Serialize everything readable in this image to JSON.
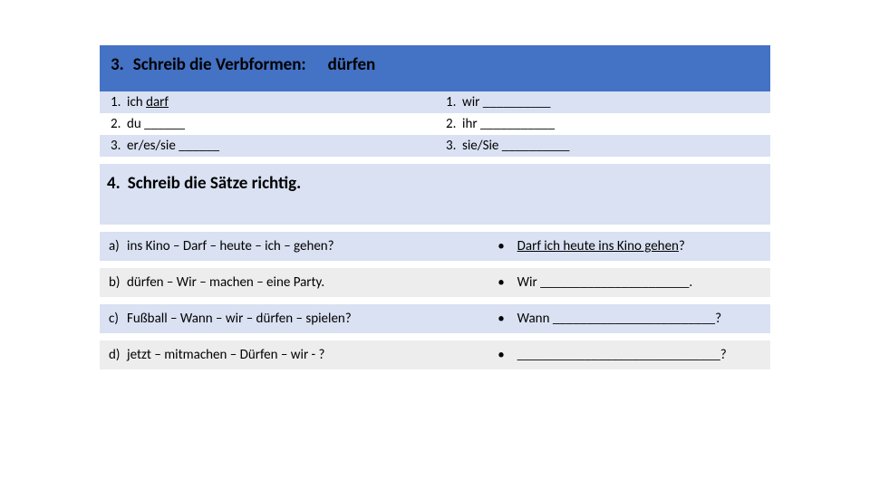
{
  "ex3": {
    "number": "3.",
    "title": "Schreib die Verbformen:",
    "verb": "dürfen",
    "left": [
      {
        "n": "1.",
        "pre": "ich ",
        "u": "darf",
        "post": ""
      },
      {
        "n": "2.",
        "pre": "du ______",
        "u": "",
        "post": ""
      },
      {
        "n": "3.",
        "pre": "er/es/sie ______",
        "u": "",
        "post": ""
      }
    ],
    "right": [
      {
        "n": "1.",
        "pre": "wir __________",
        "u": "",
        "post": ""
      },
      {
        "n": "2.",
        "pre": "ihr ___________",
        "u": "",
        "post": ""
      },
      {
        "n": "3.",
        "pre": "sie/Sie __________",
        "u": "",
        "post": ""
      }
    ]
  },
  "ex4": {
    "number": "4.",
    "title": "Schreib die Sätze richtig.",
    "rows": [
      {
        "letter": "a)",
        "prompt": "ins Kino – Darf – heute – ich – gehen?",
        "bullet": "•",
        "ans_pre": "",
        "ans_u": "Darf ich heute ins Kino gehen",
        "ans_post": "?"
      },
      {
        "letter": "b)",
        "prompt": "dürfen – Wir – machen – eine Party.",
        "bullet": "•",
        "ans_pre": "Wir ______________________.",
        "ans_u": "",
        "ans_post": ""
      },
      {
        "letter": "c)",
        "prompt": "Fußball – Wann – wir – dürfen – spielen?",
        "bullet": "•",
        "ans_pre": "Wann ________________________?",
        "ans_u": "",
        "ans_post": ""
      },
      {
        "letter": "d)",
        "prompt": "jetzt – mitmachen – Dürfen – wir - ?",
        "bullet": "•",
        "ans_pre": "______________________________?",
        "ans_u": "",
        "ans_post": ""
      }
    ]
  }
}
